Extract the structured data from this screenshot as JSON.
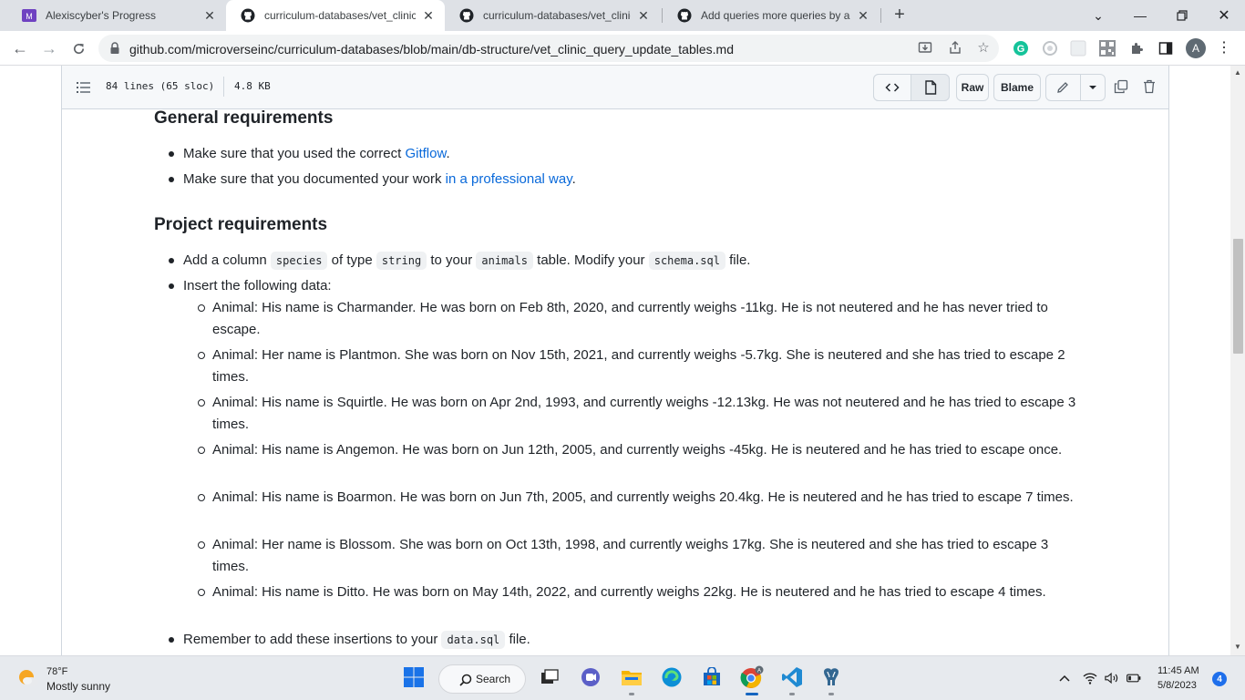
{
  "browser": {
    "tabs": [
      {
        "title": "Alexiscyber's Progress",
        "active": false
      },
      {
        "title": "curriculum-databases/vet_clinic_q",
        "active": true
      },
      {
        "title": "curriculum-databases/vet_clinic_q",
        "active": false
      },
      {
        "title": "Add queries more queries by alex",
        "active": false
      }
    ],
    "url": "github.com/microverseinc/curriculum-databases/blob/main/db-structure/vet_clinic_query_update_tables.md",
    "profile_initial": "A"
  },
  "file_header": {
    "lines_info": "84 lines (65 sloc)",
    "size": "4.8 KB",
    "raw_label": "Raw",
    "blame_label": "Blame"
  },
  "content": {
    "general_heading": "General requirements",
    "general_items": [
      {
        "before": "Make sure that you used the correct ",
        "link": "Gitflow",
        "after": "."
      },
      {
        "before": "Make sure that you documented your work ",
        "link": "in a professional way",
        "after": "."
      }
    ],
    "project_heading": "Project requirements",
    "p1": {
      "a": "Add a column ",
      "code1": "species",
      "b": " of type ",
      "code2": "string",
      "c": " to your ",
      "code3": "animals",
      "d": " table. Modify your ",
      "code4": "schema.sql",
      "e": " file."
    },
    "insert_label": "Insert the following data:",
    "animals": [
      "Animal: His name is Charmander. He was born on Feb 8th, 2020, and currently weighs -11kg. He is not neutered and he has never tried to escape.",
      "Animal: Her name is Plantmon. She was born on Nov 15th, 2021, and currently weighs -5.7kg. She is neutered and she has tried to escape 2 times.",
      "Animal: His name is Squirtle. He was born on Apr 2nd, 1993, and currently weighs -12.13kg. He was not neutered and he has tried to escape 3 times.",
      "Animal: His name is Angemon. He was born on Jun 12th, 2005, and currently weighs -45kg. He is neutered and he has tried to escape once.",
      "Animal: His name is Boarmon. He was born on Jun 7th, 2005, and currently weighs 20.4kg. He is neutered and he has tried to escape 7 times.",
      "Animal: Her name is Blossom. She was born on Oct 13th, 1998, and currently weighs 17kg. She is neutered and she has tried to escape 3 times.",
      "Animal: His name is Ditto. He was born on May 14th, 2022, and currently weighs 22kg. He is neutered and he has tried to escape 4 times."
    ],
    "remember": {
      "a": "Remember to add these insertions to your ",
      "code": "data.sql",
      "b": " file."
    }
  },
  "taskbar": {
    "weather_temp": "78°F",
    "weather_desc": "Mostly sunny",
    "search_label": "Search",
    "time": "11:45 AM",
    "date": "5/8/2023",
    "notifications": "4"
  },
  "colors": {
    "link": "#0969da",
    "code_bg": "#eff1f3",
    "accent": "#1565c0"
  }
}
